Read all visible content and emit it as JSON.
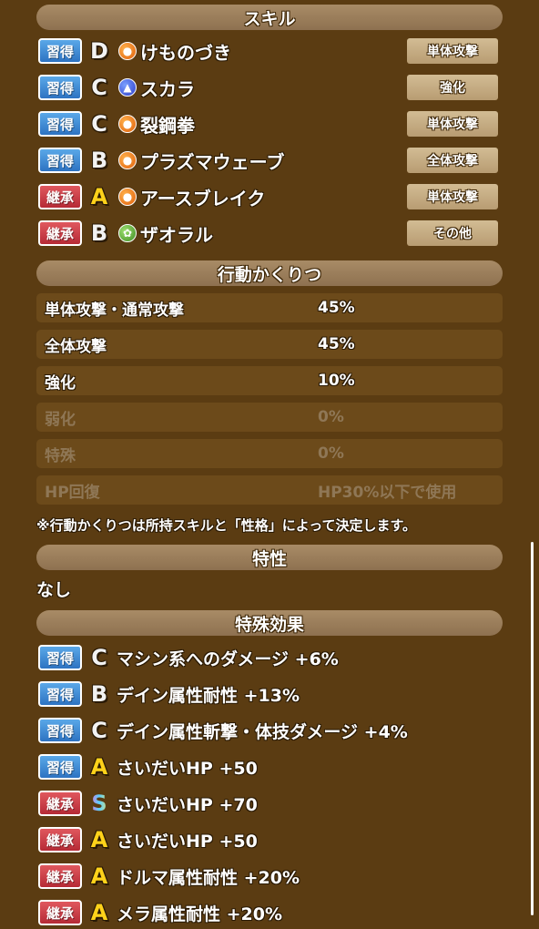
{
  "headers": {
    "skills": "スキル",
    "behavior": "行動かくりつ",
    "trait": "特性",
    "special": "特殊効果"
  },
  "skills": [
    {
      "badge": "習得",
      "badge_type": "learn",
      "rank": "D",
      "icon": "orange-orb-icon",
      "name": "けものづき",
      "category": "単体攻撃"
    },
    {
      "badge": "習得",
      "badge_type": "learn",
      "rank": "C",
      "icon": "blue-shield-orb-icon",
      "name": "スカラ",
      "category": "強化"
    },
    {
      "badge": "習得",
      "badge_type": "learn",
      "rank": "C",
      "icon": "orange-orb-icon",
      "name": "裂鋼拳",
      "category": "単体攻撃"
    },
    {
      "badge": "習得",
      "badge_type": "learn",
      "rank": "B",
      "icon": "orange-orb-icon",
      "name": "プラズマウェーブ",
      "category": "全体攻撃"
    },
    {
      "badge": "継承",
      "badge_type": "inherit",
      "rank": "A",
      "icon": "orange-orb-icon",
      "name": "アースブレイク",
      "category": "単体攻撃"
    },
    {
      "badge": "継承",
      "badge_type": "inherit",
      "rank": "B",
      "icon": "green-heal-orb-icon",
      "name": "ザオラル",
      "category": "その他"
    }
  ],
  "behavior": [
    {
      "label": "単体攻撃・通常攻撃",
      "value": "45%",
      "active": true
    },
    {
      "label": "全体攻撃",
      "value": "45%",
      "active": true
    },
    {
      "label": "強化",
      "value": "10%",
      "active": true
    },
    {
      "label": "弱化",
      "value": "0%",
      "active": false
    },
    {
      "label": "特殊",
      "value": "0%",
      "active": false
    },
    {
      "label": "HP回復",
      "value": "HP30%以下で使用",
      "active": false
    }
  ],
  "note": "※行動かくりつは所持スキルと「性格」によって決定します。",
  "trait": "なし",
  "special_effects": [
    {
      "badge": "習得",
      "badge_type": "learn",
      "rank": "C",
      "text": "マシン系へのダメージ +6%"
    },
    {
      "badge": "習得",
      "badge_type": "learn",
      "rank": "B",
      "text": "デイン属性耐性 +13%"
    },
    {
      "badge": "習得",
      "badge_type": "learn",
      "rank": "C",
      "text": "デイン属性斬撃・体技ダメージ +4%"
    },
    {
      "badge": "習得",
      "badge_type": "learn",
      "rank": "A",
      "text": "さいだいHP +50"
    },
    {
      "badge": "継承",
      "badge_type": "inherit",
      "rank": "S",
      "text": "さいだいHP +70"
    },
    {
      "badge": "継承",
      "badge_type": "inherit",
      "rank": "A",
      "text": "さいだいHP +50"
    },
    {
      "badge": "継承",
      "badge_type": "inherit",
      "rank": "A",
      "text": "ドルマ属性耐性 +20%"
    },
    {
      "badge": "継承",
      "badge_type": "inherit",
      "rank": "A",
      "text": "メラ属性耐性 +20%"
    }
  ],
  "colors": {
    "background": "#5b3c12",
    "header": "#a88b66",
    "learn_badge": "#3f8ad6",
    "inherit_badge": "#c83c44",
    "category_button": "#c5ad83"
  }
}
